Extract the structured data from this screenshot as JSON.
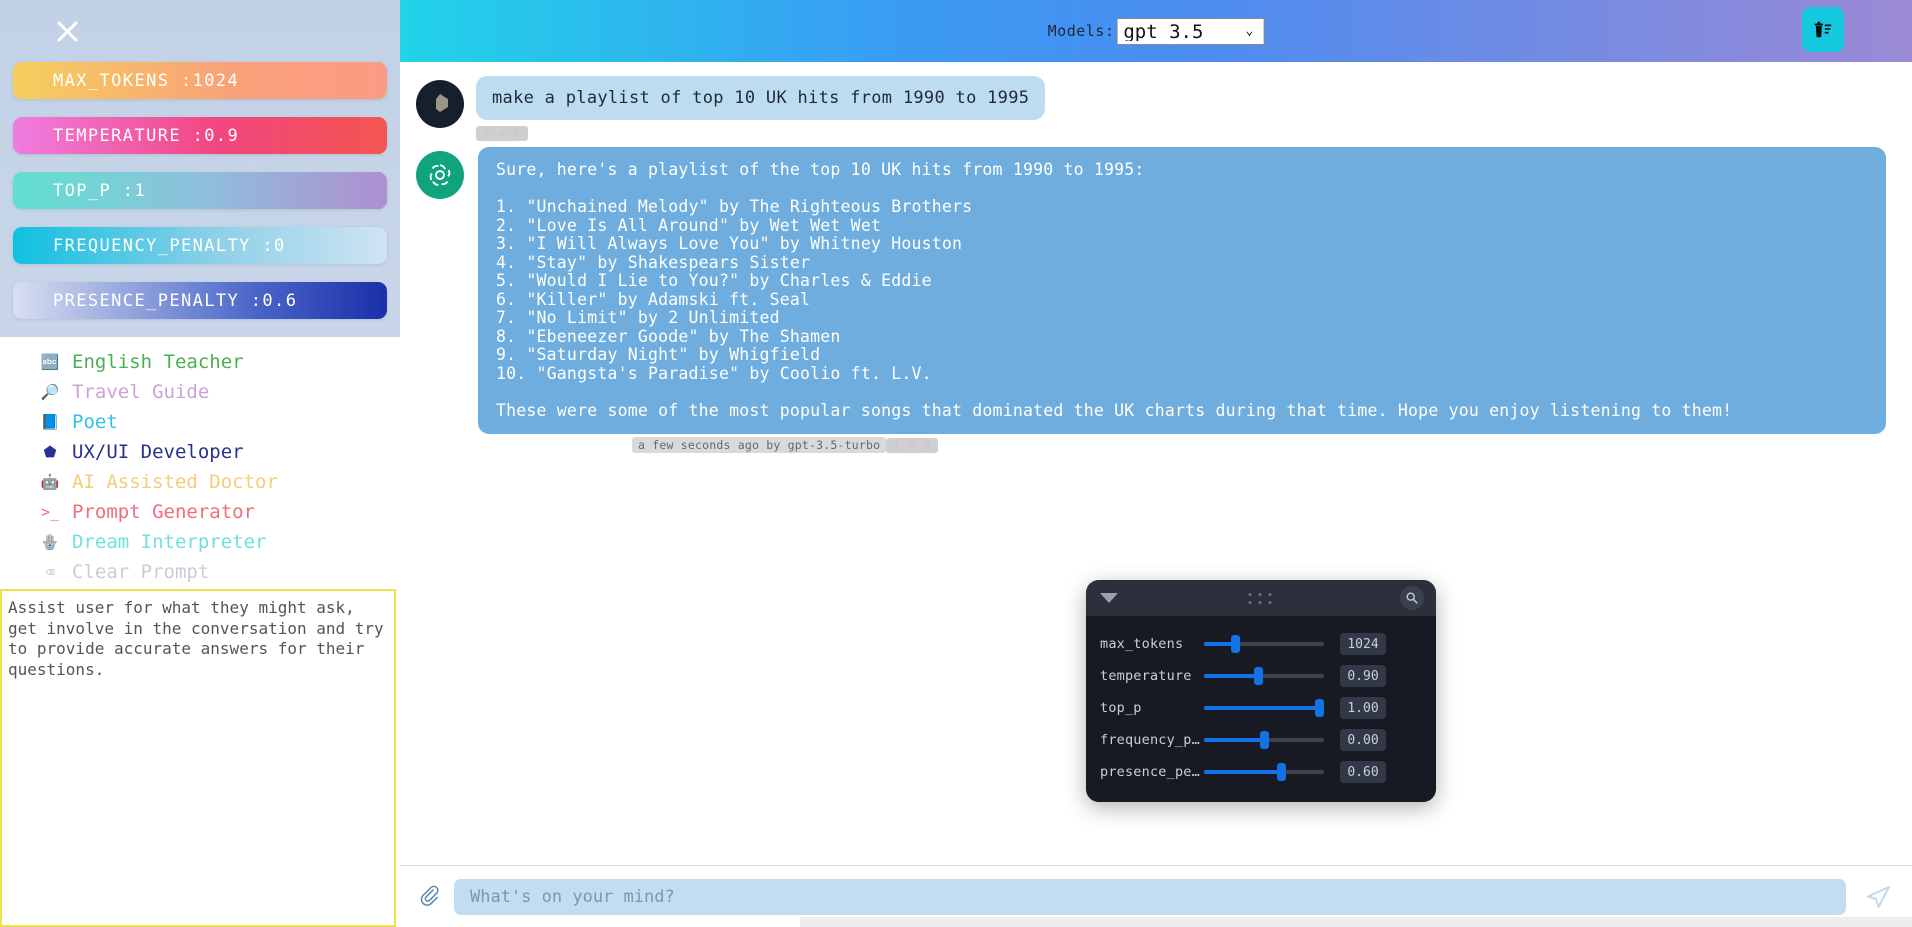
{
  "sidebar": {
    "close_icon": "close-x-icon",
    "params": [
      {
        "label": "MAX_TOKENS :1024",
        "name": "max_tokens",
        "value": "1024"
      },
      {
        "label": "TEMPERATURE :0.9",
        "name": "temperature",
        "value": "0.9"
      },
      {
        "label": "TOP_P :1",
        "name": "top_p",
        "value": "1"
      },
      {
        "label": "FREQUENCY_PENALTY :0",
        "name": "frequency_penalty",
        "value": "0"
      },
      {
        "label": "PRESENCE_PENALTY :0.6",
        "name": "presence_penalty",
        "value": "0.6"
      }
    ],
    "prompts": [
      {
        "label": "English Teacher",
        "icon": "🔤",
        "color": "#4caf50"
      },
      {
        "label": "Travel Guide",
        "icon": "🔎",
        "color": "#c9a3d8"
      },
      {
        "label": "Poet",
        "icon": "📘",
        "color": "#2ec4e0"
      },
      {
        "label": "UX/UI Developer",
        "icon": "⬟",
        "color": "#26328c"
      },
      {
        "label": "AI Assisted Doctor",
        "icon": "🤖",
        "color": "#f2cd7a"
      },
      {
        "label": "Prompt Generator",
        "icon": ">_",
        "color": "#f26d7d"
      },
      {
        "label": "Dream Interpreter",
        "icon": "🪬",
        "color": "#6fe0dc"
      },
      {
        "label": "Clear Prompt",
        "icon": "⌫",
        "color": "#c8cdd6"
      }
    ],
    "system_prompt": "Assist user for what they might ask, get involve in the conversation and try to provide accurate answers for their questions."
  },
  "topbar": {
    "models_label": "Models:",
    "model_selected": "gpt 3.5",
    "model_options": [
      "gpt 3.5"
    ],
    "chevron": "⌄",
    "clear_chat_icon": "trash-list-icon"
  },
  "chat": {
    "user_message": "make a playlist of top 10 UK hits from 1990 to 1995",
    "user_badge": "T = S",
    "bot_message": "Sure, here's a playlist of the top 10 UK hits from 1990 to 1995:\n\n1. \"Unchained Melody\" by The Righteous Brothers\n2. \"Love Is All Around\" by Wet Wet Wet\n3. \"I Will Always Love You\" by Whitney Houston\n4. \"Stay\" by Shakespears Sister\n5. \"Would I Lie to You?\" by Charles & Eddie\n6. \"Killer\" by Adamski ft. Seal\n7. \"No Limit\" by 2 Unlimited\n8. \"Ebeneezer Goode\" by The Shamen\n9. \"Saturday Night\" by Whigfield\n10. \"Gangsta's Paradise\" by Coolio ft. L.V.\n\nThese were some of the most popular songs that dominated the UK charts during that time. Hope you enjoy listening to them!",
    "bot_timestamp": "a few seconds ago by gpt-3.5-turbo",
    "bot_badge": "T = S"
  },
  "settings_panel": {
    "collapse_icon": "caret-down-icon",
    "drag_icon": "drag-dots-icon",
    "search_icon": "magnifier-icon",
    "sliders": [
      {
        "label": "max_tokens",
        "value": "1024",
        "pct": 26
      },
      {
        "label": "temperature",
        "value": "0.90",
        "pct": 45
      },
      {
        "label": "top_p",
        "value": "1.00",
        "pct": 96
      },
      {
        "label": "frequency_p…",
        "value": "0.00",
        "pct": 50
      },
      {
        "label": "presence_pe…",
        "value": "0.60",
        "pct": 64
      }
    ]
  },
  "composer": {
    "attach_icon": "paperclip-icon",
    "placeholder": "What's on your mind?",
    "value": "",
    "send_icon": "send-plane-icon"
  },
  "colors": {
    "header_start": "#21d3e8",
    "header_mid": "#4a8cf0",
    "header_end": "#9b8ad6",
    "user_bubble": "#bedcf0",
    "bot_bubble": "#6eaddd",
    "accent_cyan": "#16c8e0",
    "slider_blue": "#1373e6",
    "textarea_border": "#ece14f"
  }
}
